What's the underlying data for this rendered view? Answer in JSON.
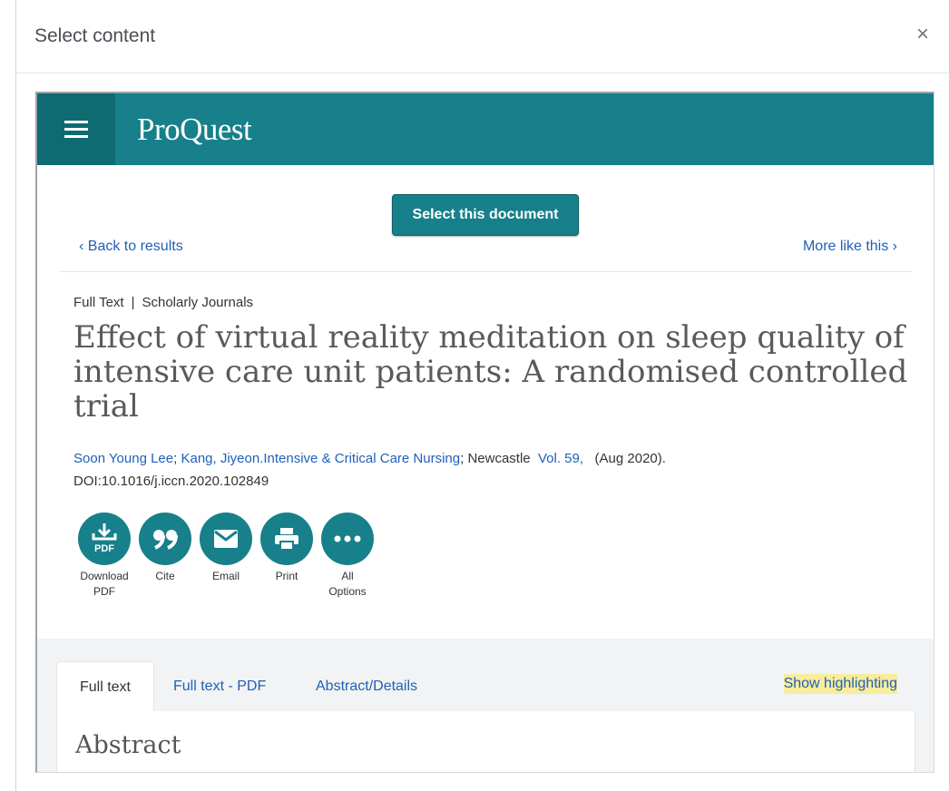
{
  "dialog": {
    "title": "Select content",
    "close_label": "×"
  },
  "header": {
    "logo": "ProQuest"
  },
  "toolbar": {
    "select_label": "Select this document"
  },
  "nav": {
    "back_label": "‹ Back to results",
    "more_label": "More like this ›"
  },
  "document": {
    "source_type": "Full Text",
    "pipe": "|",
    "journal_type": "Scholarly Journals",
    "title": "Effect of virtual reality meditation on sleep quality of intensive care unit patients: A randomised controlled trial",
    "author1": "Soon Young Lee",
    "sep1": ";",
    "author2_and_journal": "Kang, Jiyeon.Intensive & Critical Care Nursing",
    "place": "; Newcastle",
    "volume": "Vol. 59,",
    "date": "(Aug 2020).",
    "doi": "DOI:10.1016/j.iccn.2020.102849"
  },
  "actions": [
    {
      "label_line1": "Download",
      "label_line2": "PDF",
      "icon": "download-pdf-icon",
      "icon_text": "PDF"
    },
    {
      "label_line1": "Cite",
      "label_line2": "",
      "icon": "quote-icon"
    },
    {
      "label_line1": "Email",
      "label_line2": "",
      "icon": "envelope-icon"
    },
    {
      "label_line1": "Print",
      "label_line2": "",
      "icon": "printer-icon"
    },
    {
      "label_line1": "All",
      "label_line2": "Options",
      "icon": "more-dots-icon"
    }
  ],
  "tabs": [
    {
      "label": "Full text",
      "active": true
    },
    {
      "label": "Full text - PDF",
      "active": false
    },
    {
      "label": "Abstract/Details",
      "active": false
    }
  ],
  "show_highlighting": "Show highlighting",
  "section": {
    "heading": "Abstract"
  },
  "colors": {
    "brand": "#17808a",
    "brand_dark": "#0f6a72",
    "link": "#1f5fb8",
    "highlight": "#f8ec9d"
  }
}
